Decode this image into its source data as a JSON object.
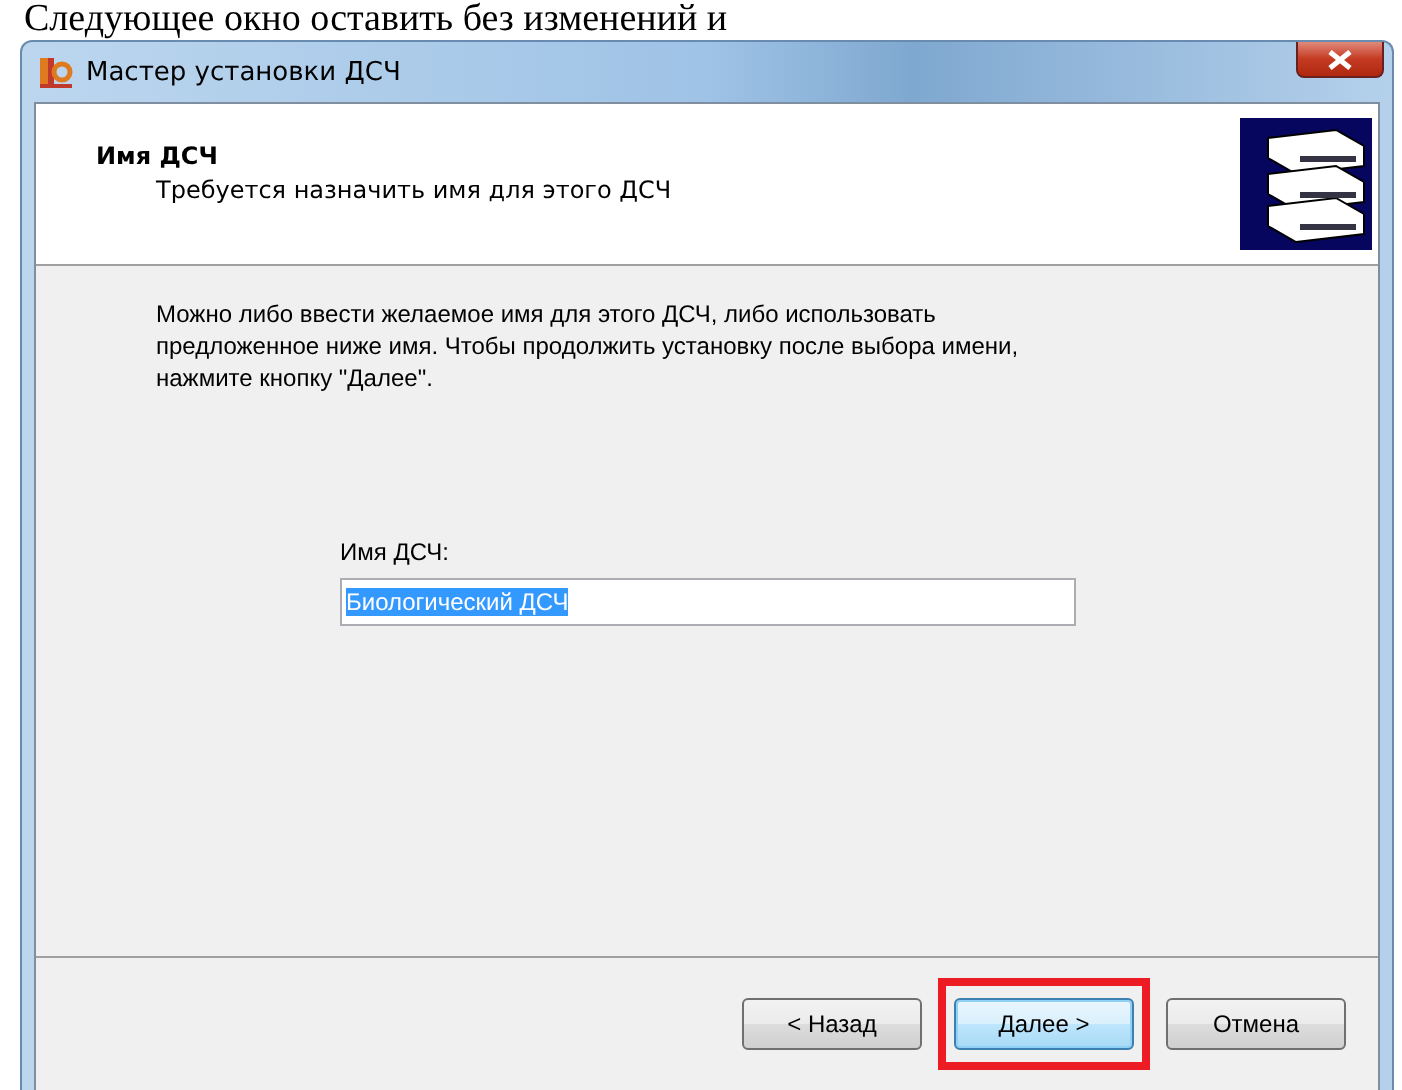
{
  "document_text": "Следующее окно оставить без изменений и",
  "window": {
    "title": "Мастер установки ДСЧ"
  },
  "header": {
    "title": "Имя ДСЧ",
    "subtitle": "Требуется назначить имя для этого ДСЧ"
  },
  "description": "Можно либо ввести желаемое имя для этого ДСЧ, либо использовать предложенное ниже имя. Чтобы продолжить установку после выбора имени, нажмите кнопку \"Далее\".",
  "name_field": {
    "label": "Имя ДСЧ:",
    "value": "Биологический ДСЧ",
    "selected": true
  },
  "buttons": [
    {
      "label": "< Назад",
      "focused": false,
      "highlighted": false
    },
    {
      "label": "Далее >",
      "focused": true,
      "highlighted": true
    },
    {
      "label": "Отмена",
      "focused": false,
      "highlighted": false
    }
  ]
}
